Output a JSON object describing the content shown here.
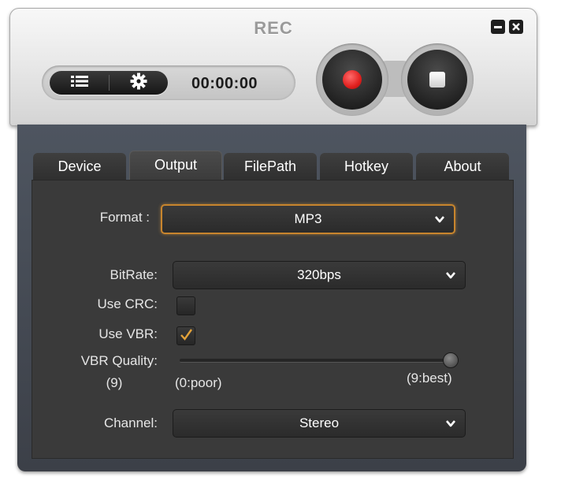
{
  "window": {
    "title": "REC",
    "minimize_icon": "minimize-icon",
    "close_icon": "close-icon"
  },
  "toolbar": {
    "list_icon": "list-icon",
    "settings_icon": "gear-icon",
    "timer": "00:00:00",
    "record_icon": "record-icon",
    "stop_icon": "stop-icon"
  },
  "tabs": [
    {
      "label": "Device",
      "active": false
    },
    {
      "label": "Output",
      "active": true
    },
    {
      "label": "FilePath",
      "active": false
    },
    {
      "label": "Hotkey",
      "active": false
    },
    {
      "label": "About",
      "active": false
    }
  ],
  "output": {
    "format": {
      "label": "Format :",
      "value": "MP3"
    },
    "bitrate": {
      "label": "BitRate:",
      "value": "320bps"
    },
    "use_crc": {
      "label": "Use CRC:",
      "checked": false
    },
    "use_vbr": {
      "label": "Use VBR:",
      "checked": true
    },
    "vbr_quality": {
      "label": "VBR Quality:",
      "current": "(9)",
      "min_label": "(0:poor)",
      "max_label": "(9:best)",
      "value": 9,
      "min": 0,
      "max": 9
    },
    "channel": {
      "label": "Channel:",
      "value": "Stereo"
    }
  },
  "colors": {
    "accent": "#c8852d",
    "record_red": "#e0201e",
    "panel_bg": "#3a3a3a"
  }
}
